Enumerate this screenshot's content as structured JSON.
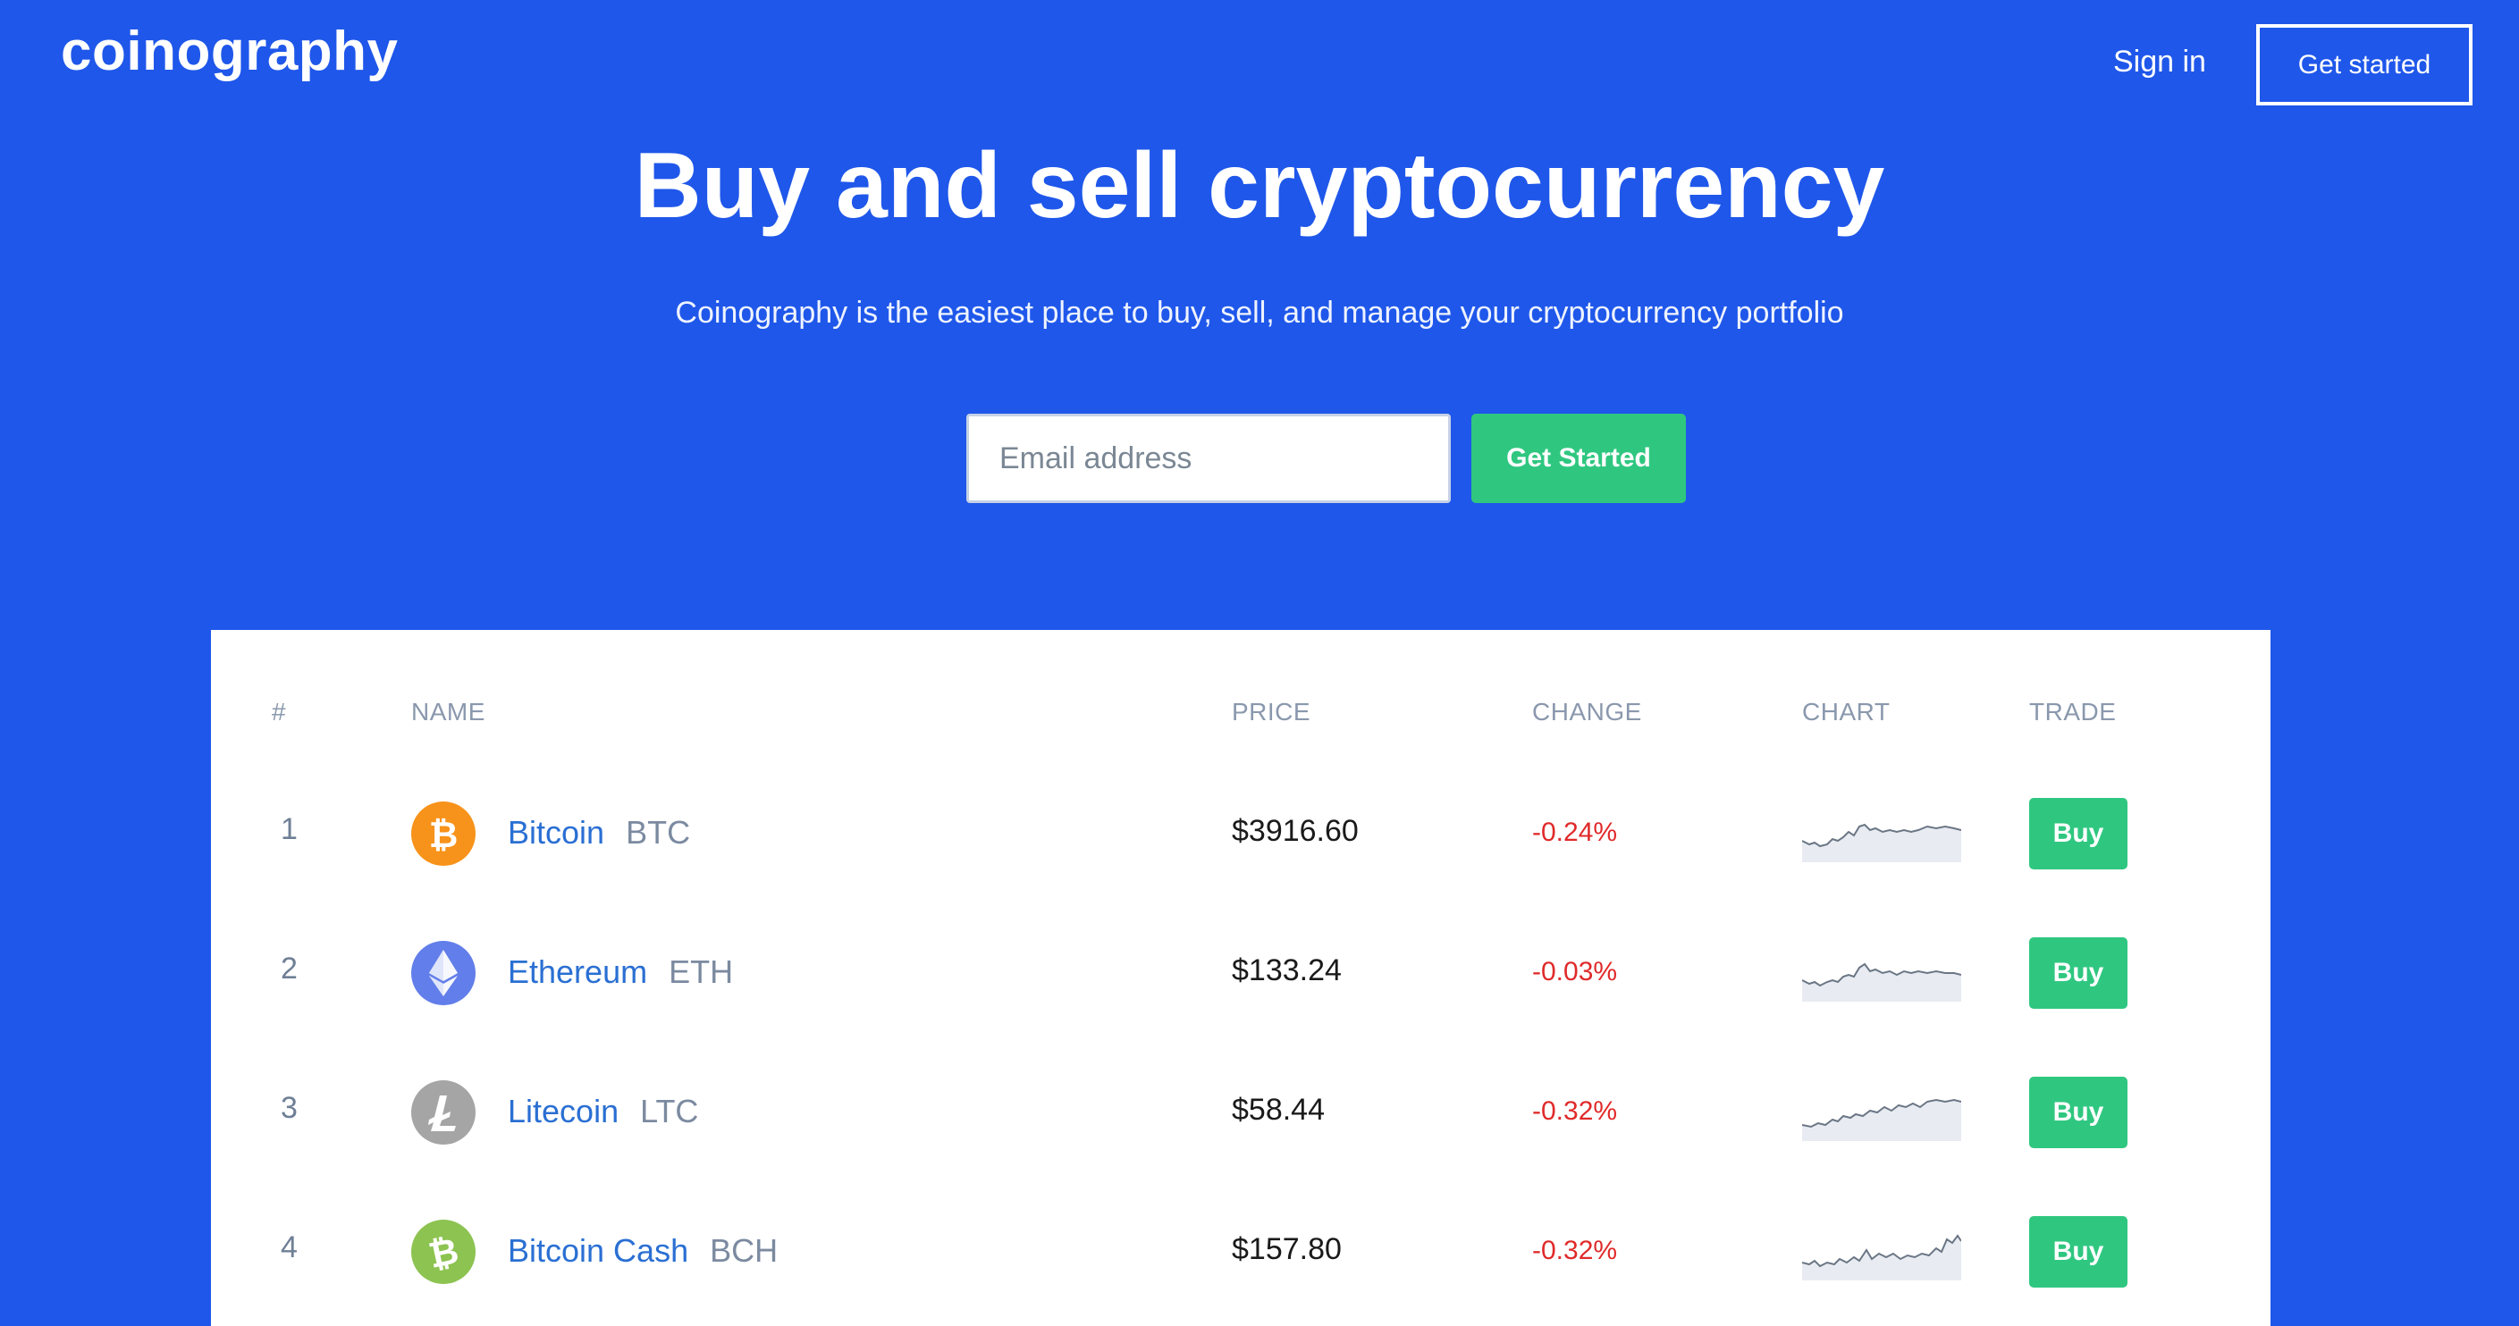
{
  "header": {
    "logo": "coinography",
    "sign_in": "Sign in",
    "get_started": "Get started"
  },
  "hero": {
    "title": "Buy and sell cryptocurrency",
    "subtitle": "Coinography is the easiest place to buy, sell, and manage your cryptocurrency portfolio",
    "email_placeholder": "Email address",
    "email_value": "",
    "cta": "Get Started"
  },
  "table": {
    "headers": {
      "rank": "#",
      "name": "NAME",
      "price": "PRICE",
      "change": "CHANGE",
      "chart": "CHART",
      "trade": "TRADE"
    },
    "rows": [
      {
        "rank": "1",
        "name": "Bitcoin",
        "symbol": "BTC",
        "price": "$3916.60",
        "change": "-0.24%",
        "buy": "Buy",
        "icon": "bitcoin-icon",
        "icon_color": "#f7931a"
      },
      {
        "rank": "2",
        "name": "Ethereum",
        "symbol": "ETH",
        "price": "$133.24",
        "change": "-0.03%",
        "buy": "Buy",
        "icon": "ethereum-icon",
        "icon_color": "#627eea"
      },
      {
        "rank": "3",
        "name": "Litecoin",
        "symbol": "LTC",
        "price": "$58.44",
        "change": "-0.32%",
        "buy": "Buy",
        "icon": "litecoin-icon",
        "icon_color": "#a5a5a5"
      },
      {
        "rank": "4",
        "name": "Bitcoin Cash",
        "symbol": "BCH",
        "price": "$157.80",
        "change": "-0.32%",
        "buy": "Buy",
        "icon": "bitcoin-cash-icon",
        "icon_color": "#8dc351"
      }
    ]
  },
  "colors": {
    "background": "#1f57ea",
    "accent_green": "#2fc780",
    "negative": "#e02a2a",
    "link_blue": "#2a6fd3"
  }
}
